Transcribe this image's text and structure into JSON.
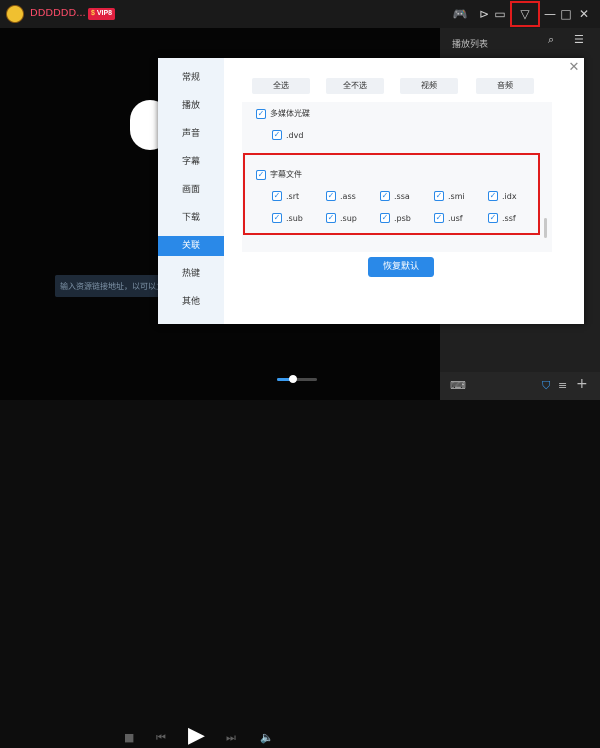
{
  "app": {
    "title": "DDDDDD...",
    "vip_s": "$",
    "vip_label": "VIP8"
  },
  "titlebar_icons": [
    "gamepad-icon",
    "pin-icon",
    "folder-icon",
    "dropdown-icon",
    "minimize-icon",
    "maximize-icon",
    "close-icon"
  ],
  "playlist": {
    "title": "播放列表"
  },
  "player": {
    "url_placeholder": "输入资源链接地址，以可以立即"
  },
  "settings": {
    "sidebar": [
      "常规",
      "播放",
      "声音",
      "字幕",
      "画面",
      "下载",
      "关联",
      "热键",
      "其他"
    ],
    "active_index": 6,
    "top_buttons": [
      "全选",
      "全不选",
      "视频",
      "音频"
    ],
    "media_disc": {
      "label": "多媒体光碟",
      "items": [
        ".dvd"
      ]
    },
    "subtitle_files": {
      "label": "字幕文件",
      "items": [
        ".srt",
        ".ass",
        ".ssa",
        ".smi",
        ".idx",
        ".sub",
        ".sup",
        ".psb",
        ".usf",
        ".ssf"
      ]
    },
    "restore_button": "恢复默认"
  },
  "controls": {
    "volume": 0.4
  },
  "colors": {
    "accent": "#2a89e8",
    "highlight": "#e01c1c",
    "brand": "#ff4d6a"
  }
}
